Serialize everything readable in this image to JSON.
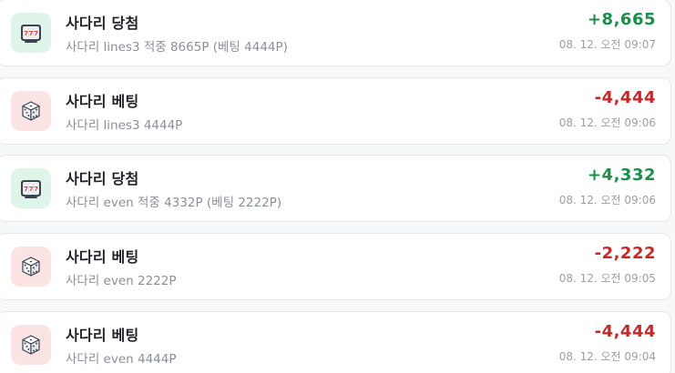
{
  "colors": {
    "positive": "#1a8f4a",
    "negative": "#c62828",
    "win_icon_bg": "#dff5ea",
    "bet_icon_bg": "#fde4e4"
  },
  "items": [
    {
      "kind": "win",
      "icon": "slot-machine-icon",
      "title": "사다리 당첨",
      "desc": "사다리 lines3 적중 8665P (베팅 4444P)",
      "amount": "+8,665",
      "time": "08. 12. 오전 09:07"
    },
    {
      "kind": "bet",
      "icon": "dice-icon",
      "title": "사다리 베팅",
      "desc": "사다리 lines3 4444P",
      "amount": "-4,444",
      "time": "08. 12. 오전 09:06"
    },
    {
      "kind": "win",
      "icon": "slot-machine-icon",
      "title": "사다리 당첨",
      "desc": "사다리 even 적중 4332P (베팅 2222P)",
      "amount": "+4,332",
      "time": "08. 12. 오전 09:06"
    },
    {
      "kind": "bet",
      "icon": "dice-icon",
      "title": "사다리 베팅",
      "desc": "사다리 even 2222P",
      "amount": "-2,222",
      "time": "08. 12. 오전 09:05"
    },
    {
      "kind": "bet",
      "icon": "dice-icon",
      "title": "사다리 베팅",
      "desc": "사다리 even 4444P",
      "amount": "-4,444",
      "time": "08. 12. 오전 09:04"
    }
  ]
}
